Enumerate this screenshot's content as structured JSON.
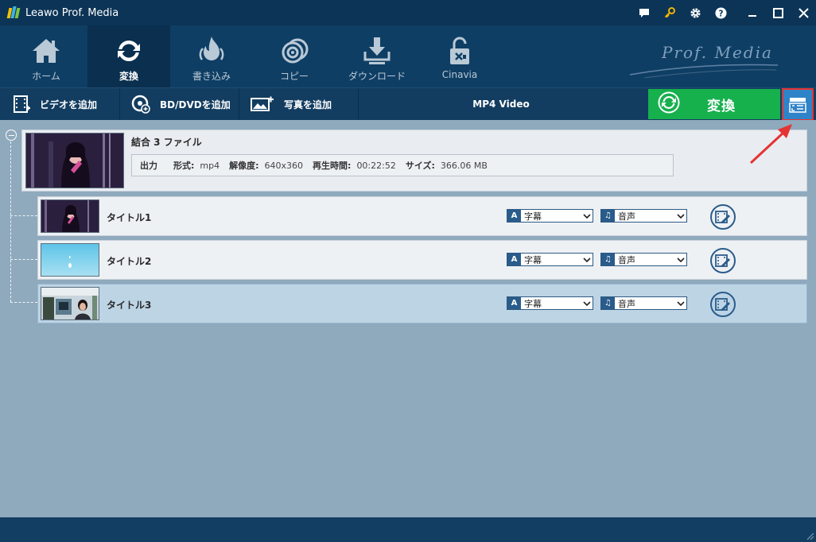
{
  "window": {
    "title": "Leawo Prof. Media",
    "icons": [
      "feedback-icon",
      "key-icon",
      "gear-icon",
      "help-icon",
      "minimize-icon",
      "maximize-icon",
      "close-icon"
    ]
  },
  "nav": {
    "items": [
      {
        "label": "ホーム",
        "icon": "home-icon"
      },
      {
        "label": "変換",
        "icon": "convert-icon",
        "active": true
      },
      {
        "label": "書き込み",
        "icon": "burn-icon"
      },
      {
        "label": "コピー",
        "icon": "copy-disc-icon"
      },
      {
        "label": "ダウンロード",
        "icon": "download-icon"
      },
      {
        "label": "Cinavia",
        "icon": "unlock-icon"
      }
    ],
    "brand": "Prof. Media"
  },
  "toolbar": {
    "add_video": "ビデオを追加",
    "add_bd_dvd": "BD/DVDを追加",
    "add_photo": "写真を追加",
    "format": "MP4 Video",
    "convert": "変換"
  },
  "merged": {
    "name": "結合 3 ファイル",
    "output_label": "出力",
    "format_label": "形式:",
    "format_value": "mp4",
    "resolution_label": "解像度:",
    "resolution_value": "640x360",
    "duration_label": "再生時間:",
    "duration_value": "00:22:52",
    "size_label": "サイズ:",
    "size_value": "366.06 MB"
  },
  "titles": [
    {
      "name": "タイトル1",
      "subtitle": "字幕",
      "audio": "音声"
    },
    {
      "name": "タイトル2",
      "subtitle": "字幕",
      "audio": "音声"
    },
    {
      "name": "タイトル3",
      "subtitle": "字幕",
      "audio": "音声",
      "selected": true
    }
  ],
  "colors": {
    "convert_green": "#16b04d",
    "nav_bg": "#0f3e64",
    "main_bg": "#8fa9bd",
    "highlight_red": "#e53333"
  }
}
